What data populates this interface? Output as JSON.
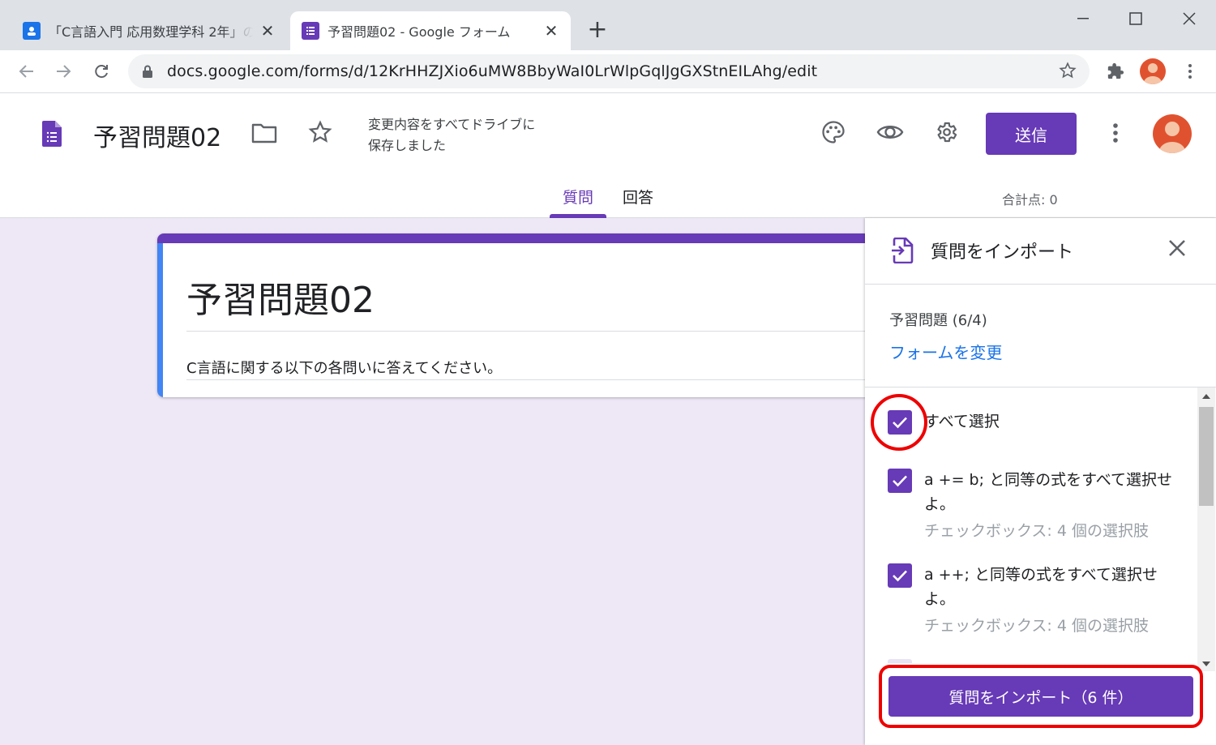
{
  "browser": {
    "tabs": [
      {
        "title": "「C言語入門 応用数理学科 2年」の",
        "active": false,
        "favicon": "classroom-icon"
      },
      {
        "title": "予習問題02 - Google フォーム",
        "active": true,
        "favicon": "forms-icon"
      }
    ],
    "url": "docs.google.com/forms/d/12KrHHZJXio6uMW8BbyWaI0LrWlpGqlJgGXStnEILAhg/edit"
  },
  "header": {
    "form_title": "予習問題02",
    "save_status_line1": "変更内容をすべてドライブに",
    "save_status_line2": "保存しました",
    "send_label": "送信",
    "tabs": [
      "質問",
      "回答"
    ],
    "total_points": "合計点: 0"
  },
  "card": {
    "title": "予習問題02",
    "description": "C言語に関する以下の各問いに答えてください。"
  },
  "panel": {
    "title": "質問をインポート",
    "source_form": "予習問題 (6/4)",
    "change_form_link": "フォームを変更",
    "select_all_label": "すべて選択",
    "questions": [
      {
        "text": "a += b; と同等の式をすべて選択せよ。",
        "type": "チェックボックス: 4 個の選択肢"
      },
      {
        "text": "a ++; と同等の式をすべて選択せよ。",
        "type": "チェックボックス: 4 個の選択肢"
      }
    ],
    "import_button": "質問をインポート（6 件）"
  },
  "colors": {
    "accent": "#673ab7",
    "highlight": "#e00000",
    "canvas": "#ede7f6",
    "link": "#1a73e8"
  }
}
